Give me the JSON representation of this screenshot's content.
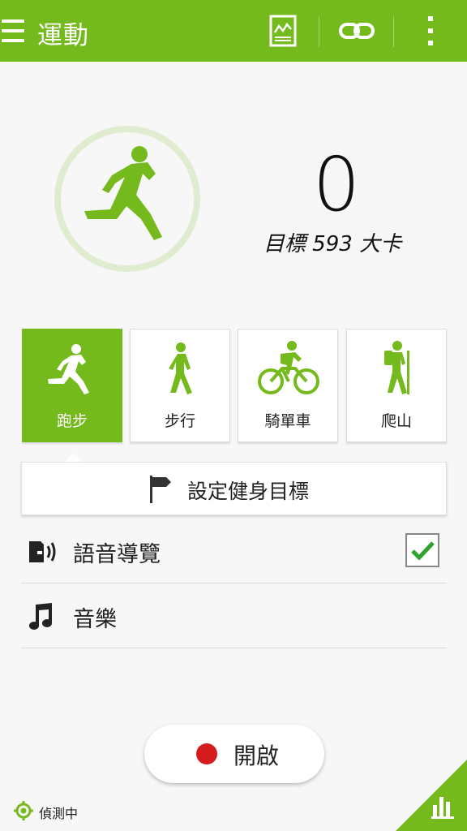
{
  "appbar": {
    "title": "運動",
    "color": "#74ba1c"
  },
  "summary": {
    "calories": "0",
    "goal_text": "目標 593 大卡"
  },
  "modes": [
    {
      "label": "跑步",
      "icon": "running-icon",
      "active": true
    },
    {
      "label": "步行",
      "icon": "walking-icon",
      "active": false
    },
    {
      "label": "騎單車",
      "icon": "cycling-icon",
      "active": false
    },
    {
      "label": "爬山",
      "icon": "hiking-icon",
      "active": false
    }
  ],
  "goal_button": {
    "label": "設定健身目標",
    "icon": "flag-icon"
  },
  "settings": [
    {
      "label": "語音導覽",
      "icon": "voice-guide-icon",
      "checked": true
    },
    {
      "label": "音樂",
      "icon": "music-note-icon"
    }
  ],
  "start_button": {
    "label": "開啟"
  },
  "status": {
    "gps_label": "偵測中"
  }
}
